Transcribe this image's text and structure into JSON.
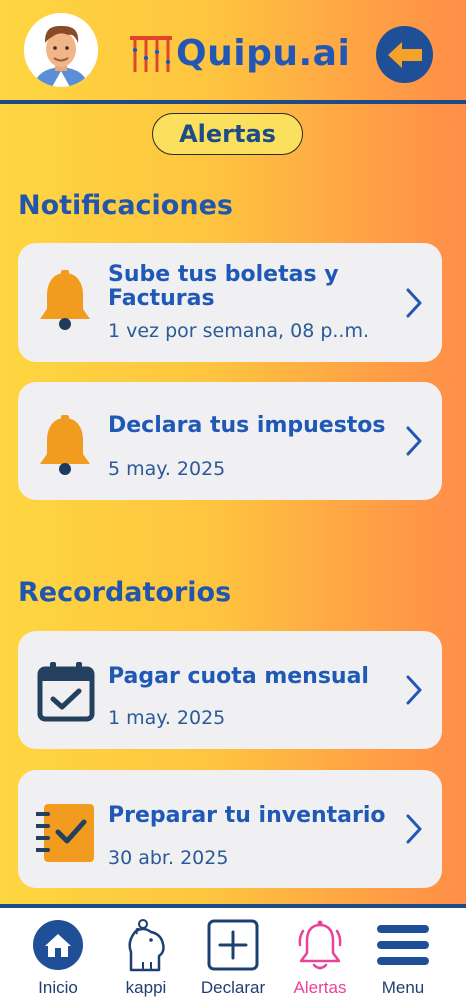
{
  "header": {
    "logo_text": "Quipu.ai"
  },
  "page": {
    "title": "Alertas"
  },
  "notifications": {
    "heading": "Notificaciones",
    "items": [
      {
        "title": "Sube tus boletas y Facturas",
        "subtitle": "1 vez por semana, 08 p..m.",
        "icon": "bell-icon"
      },
      {
        "title": "Declara tus impuestos",
        "subtitle": "5 may. 2025",
        "icon": "bell-icon"
      }
    ]
  },
  "reminders": {
    "heading": "Recordatorios",
    "items": [
      {
        "title": "Pagar cuota mensual",
        "subtitle": "1 may. 2025",
        "icon": "calendar-check-icon"
      },
      {
        "title": "Preparar tu inventario",
        "subtitle": "30 abr. 2025",
        "icon": "checklist-icon"
      }
    ]
  },
  "nav": {
    "items": [
      {
        "label": "Inicio",
        "icon": "home-icon"
      },
      {
        "label": "kappi",
        "icon": "capybara-icon"
      },
      {
        "label": "Declarar",
        "icon": "plus-square-icon"
      },
      {
        "label": "Alertas",
        "icon": "bell-outline-icon",
        "active": true
      },
      {
        "label": "Menu",
        "icon": "hamburger-icon"
      }
    ]
  },
  "colors": {
    "brand_blue": "#1f58b5",
    "dark_blue": "#1e4b86",
    "bell_orange": "#f29c1f",
    "active_pink": "#e8439a",
    "card_bg": "#f0f0f2"
  }
}
